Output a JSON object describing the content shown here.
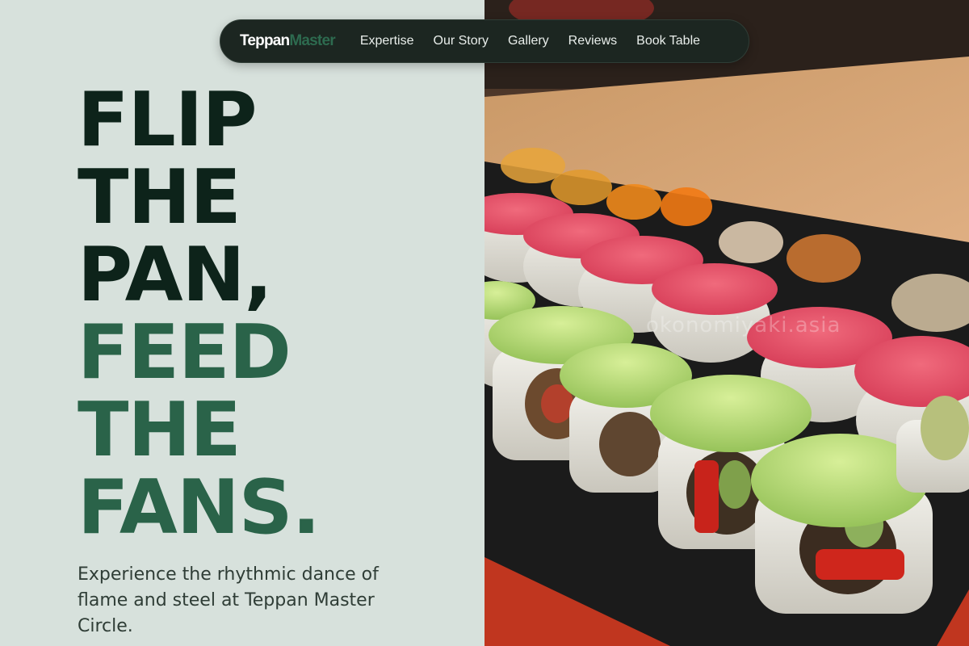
{
  "brand": {
    "name_first": "Teppan",
    "name_second": "Master"
  },
  "nav": {
    "items": [
      {
        "label": "Expertise"
      },
      {
        "label": "Our Story"
      },
      {
        "label": "Gallery"
      },
      {
        "label": "Reviews"
      },
      {
        "label": "Book Table"
      }
    ]
  },
  "hero": {
    "headline_lines": [
      "FLIP",
      "THE",
      "PAN,",
      "FEED",
      "THE",
      "FANS."
    ],
    "subtitle": "Experience the rhythmic dance of flame and steel at Teppan Master Circle.",
    "image_watermark": "okonomiyaki.asia"
  },
  "colors": {
    "left_background": "#d7e1dc",
    "headline_dark": "#0d231a",
    "headline_green": "#2a6349",
    "nav_background": "#1c2621",
    "brand_accent": "#2d6a4f"
  }
}
